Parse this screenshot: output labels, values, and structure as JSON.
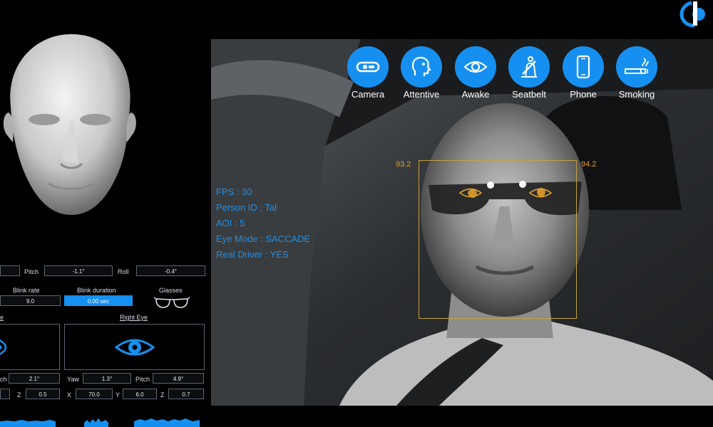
{
  "status_bar": {
    "items": [
      {
        "label": "Camera",
        "icon": "camera-icon"
      },
      {
        "label": "Attentive",
        "icon": "head-attentive-icon"
      },
      {
        "label": "Awake",
        "icon": "eye-icon"
      },
      {
        "label": "Seatbelt",
        "icon": "seatbelt-icon"
      },
      {
        "label": "Phone",
        "icon": "phone-icon"
      },
      {
        "label": "Smoking",
        "icon": "cigarette-icon"
      }
    ],
    "color": "#1690f0"
  },
  "overlay": {
    "fps": "FPS : 30",
    "person_id": "Person ID : Tal",
    "aoi": "AOI : 5",
    "eye_mode": "Eye Mode : SACCADE",
    "real_driver": "Real Driver : YES"
  },
  "scores": {
    "left": "93.2",
    "right": "94.2"
  },
  "left_panel": {
    "pitch_label": "Pitch",
    "pitch_value": "-1.1°",
    "roll_label": "Roll",
    "roll_value": "-0.4°",
    "blink_rate_label": "Blink rate",
    "blink_rate_value": "9.0",
    "blink_duration_label": "Blink duration",
    "blink_duration_value": "0.00 sec",
    "glasses_label": "Glasses",
    "left_eye_label": "e",
    "right_eye_label": "Right  Eye",
    "left_eye_pitch_label": "ch",
    "left_eye_pitch_value": "2.1°",
    "left_eye_z_label": "Z",
    "left_eye_z_value": "0.5",
    "right_eye_yaw_label": "Yaw",
    "right_eye_yaw_value": "1.3°",
    "right_eye_pitch_label": "Pitch",
    "right_eye_pitch_value": "4.9°",
    "right_eye_x_label": "X",
    "right_eye_x_value": "70.0",
    "right_eye_y_label": "Y",
    "right_eye_y_value": "6.0",
    "right_eye_z_label": "Z",
    "right_eye_z_value": "0.7"
  },
  "colors": {
    "accent": "#1690f0",
    "face_box": "#c8a040",
    "overlay_text": "#1e8fe8"
  }
}
